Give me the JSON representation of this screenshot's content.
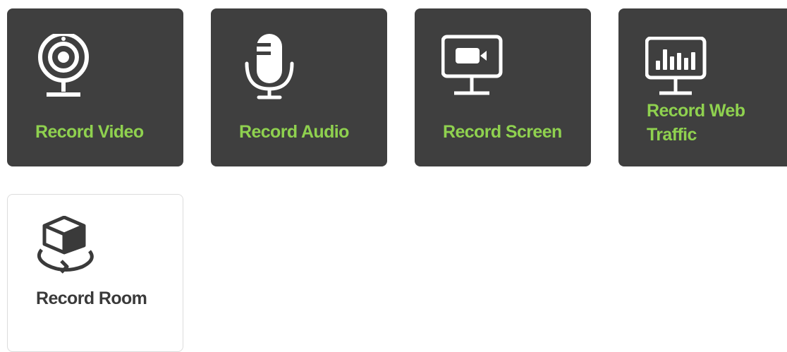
{
  "colors": {
    "tile_dark": "#3f3f3f",
    "accent": "#8fd14f",
    "dark_text": "#3a3a3a"
  },
  "tiles": [
    {
      "label": "Record Video",
      "icon": "webcam-icon"
    },
    {
      "label": "Record Audio",
      "icon": "microphone-icon"
    },
    {
      "label": "Record Screen",
      "icon": "screen-recorder-icon"
    },
    {
      "label": "Record Web Traffic",
      "icon": "web-traffic-icon"
    },
    {
      "label": "Record Room",
      "icon": "room-cube-icon"
    }
  ]
}
